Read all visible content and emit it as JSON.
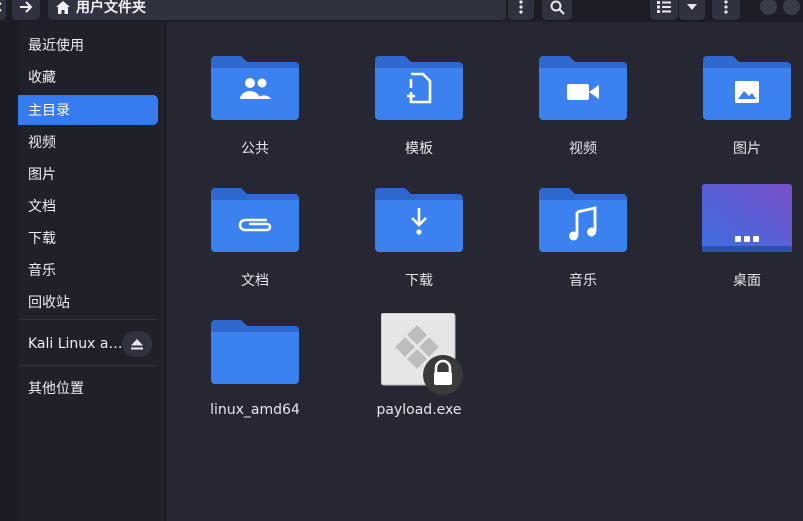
{
  "window": {
    "path_title": "用户文件夹"
  },
  "sidebar": {
    "items": [
      {
        "label": "最近使用",
        "icon": "clock-icon"
      },
      {
        "label": "收藏",
        "icon": "star-icon"
      },
      {
        "label": "主目录",
        "icon": "home-icon",
        "active": true
      },
      {
        "label": "视频",
        "icon": "video-icon"
      },
      {
        "label": "图片",
        "icon": "image-icon"
      },
      {
        "label": "文档",
        "icon": "document-icon"
      },
      {
        "label": "下载",
        "icon": "download-icon"
      },
      {
        "label": "音乐",
        "icon": "music-icon"
      },
      {
        "label": "回收站",
        "icon": "trash-icon"
      }
    ],
    "drive": {
      "label": "Kali Linux a…",
      "icon": "drive-icon"
    },
    "other": {
      "label": "其他位置",
      "icon": "plus-icon"
    }
  },
  "files": [
    {
      "label": "公共",
      "type": "folder",
      "emblem": "people-icon"
    },
    {
      "label": "模板",
      "type": "folder",
      "emblem": "template-icon"
    },
    {
      "label": "视频",
      "type": "folder",
      "emblem": "video-icon"
    },
    {
      "label": "图片",
      "type": "folder",
      "emblem": "image-icon"
    },
    {
      "label": "文档",
      "type": "folder",
      "emblem": "paperclip-icon"
    },
    {
      "label": "下载",
      "type": "folder",
      "emblem": "download-icon"
    },
    {
      "label": "音乐",
      "type": "folder",
      "emblem": "music-icon"
    },
    {
      "label": "桌面",
      "type": "desktop",
      "emblem": "dots-icon"
    },
    {
      "label": "linux_amd64",
      "type": "folder",
      "emblem": ""
    },
    {
      "label": "payload.exe",
      "type": "executable",
      "emblem": "lock-icon"
    }
  ],
  "colors": {
    "accent": "#367bf0",
    "folder_back": "#2f68cf",
    "folder_front": "#3b82f0",
    "sidebar_bg": "#1f2029",
    "main_bg": "#262733"
  }
}
